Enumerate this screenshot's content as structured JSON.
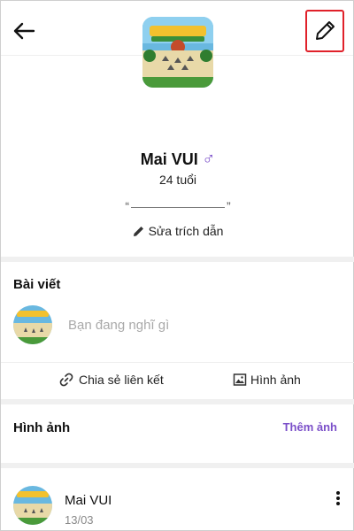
{
  "profile": {
    "name": "Mai VUI",
    "gender_symbol": "♂",
    "age": "24 tuổi",
    "quote_open": "“",
    "quote_close": "”",
    "edit_quote_label": "Sửa trích dẫn"
  },
  "posts": {
    "title": "Bài viết",
    "placeholder": "Bạn đang nghĩ gì",
    "share_link_label": "Chia sẻ liên kết",
    "image_label": "Hình ảnh"
  },
  "images": {
    "title": "Hình ảnh",
    "add_label": "Thêm ảnh"
  },
  "feed": {
    "author": "Mai VUI",
    "date": "13/03"
  },
  "colors": {
    "accent": "#7b4fc9",
    "highlight_border": "#e0212a",
    "divider": "#f0f0f0"
  },
  "icons": {
    "back": "arrow-left-icon",
    "edit": "pencil-icon",
    "link": "link-icon",
    "image": "image-icon",
    "more": "more-vertical-icon"
  }
}
